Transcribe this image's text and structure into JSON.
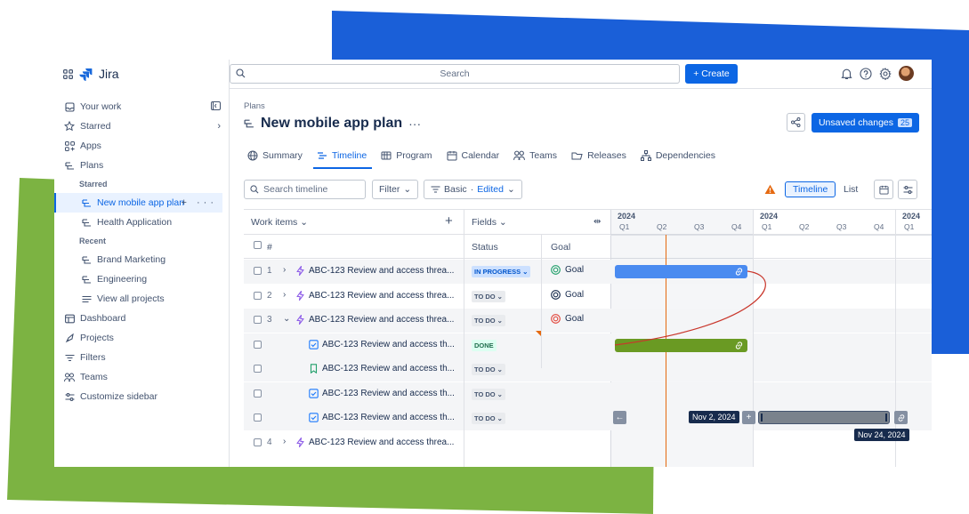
{
  "colors": {
    "accent": "#0c66e4",
    "deco_blue": "#1a5fd8",
    "deco_green": "#7cb342",
    "today_line": "#e56910"
  },
  "app": {
    "name": "Jira"
  },
  "sidebar": {
    "items": [
      {
        "label": "Your work",
        "icon": "your-work-icon"
      },
      {
        "label": "Starred",
        "icon": "star-icon"
      },
      {
        "label": "Apps",
        "icon": "apps-icon"
      },
      {
        "label": "Plans",
        "icon": "plans-icon"
      }
    ],
    "starred_heading": "Starred",
    "starred": [
      {
        "label": "New mobile app plan",
        "active": true
      },
      {
        "label": "Health Application"
      }
    ],
    "recent_heading": "Recent",
    "recent": [
      {
        "label": "Brand Marketing"
      },
      {
        "label": "Engineering"
      },
      {
        "label": "View all projects"
      }
    ],
    "bottom": [
      {
        "label": "Dashboard",
        "icon": "dashboard-icon"
      },
      {
        "label": "Projects",
        "icon": "projects-icon"
      },
      {
        "label": "Filters",
        "icon": "filter-icon"
      },
      {
        "label": "Teams",
        "icon": "teams-icon"
      },
      {
        "label": "Customize sidebar",
        "icon": "customize-icon"
      }
    ]
  },
  "topbar": {
    "search_placeholder": "Search",
    "create_label": "+ Create"
  },
  "header": {
    "breadcrumb": "Plans",
    "title": "New mobile app plan",
    "more": "···",
    "unsaved_label": "Unsaved changes",
    "unsaved_count": "25"
  },
  "tabs": [
    {
      "label": "Summary",
      "icon": "globe-icon"
    },
    {
      "label": "Timeline",
      "icon": "timeline-icon",
      "active": true
    },
    {
      "label": "Program",
      "icon": "program-icon"
    },
    {
      "label": "Calendar",
      "icon": "calendar-icon"
    },
    {
      "label": "Teams",
      "icon": "teams-icon"
    },
    {
      "label": "Releases",
      "icon": "releases-icon"
    },
    {
      "label": "Dependencies",
      "icon": "dependencies-icon"
    }
  ],
  "toolbar": {
    "search_placeholder": "Search timeline",
    "filter_label": "Filter",
    "basic_label": "Basic",
    "edited_label": "Edited",
    "view_timeline": "Timeline",
    "view_list": "List"
  },
  "grid": {
    "work_items_label": "Work items",
    "fields_label": "Fields",
    "hash": "#",
    "status_col": "Status",
    "goal_col": "Goal",
    "rows": [
      {
        "num": "1",
        "chev": "›",
        "title": "ABC-123 Review and access threa...",
        "status": "IN PROGRESS",
        "status_kind": "inprog",
        "goal": "Goal",
        "goal_color": "#22a06b",
        "type": "epic",
        "shade": true
      },
      {
        "num": "2",
        "chev": "›",
        "title": "ABC-123 Review and access threa...",
        "status": "TO DO",
        "status_kind": "todo",
        "goal": "Goal",
        "goal_color": "#172b4d",
        "type": "epic",
        "shade": false
      },
      {
        "num": "3",
        "chev": "⌄",
        "title": "ABC-123 Review and access threa...",
        "status": "TO DO",
        "status_kind": "todo",
        "goal": "Goal",
        "goal_color": "#e2483d",
        "type": "epic",
        "shade": true
      },
      {
        "num": "",
        "chev": "",
        "title": "ABC-123 Review and access th...",
        "status": "DONE",
        "status_kind": "done",
        "goal": "",
        "type": "task",
        "shade": true
      },
      {
        "num": "",
        "chev": "",
        "title": "ABC-123 Review and access th...",
        "status": "TO DO",
        "status_kind": "todo",
        "goal": "",
        "type": "story",
        "shade": true
      },
      {
        "num": "",
        "chev": "",
        "title": "ABC-123 Review and access th...",
        "status": "TO DO",
        "status_kind": "todo",
        "goal": "",
        "type": "task",
        "shade": true
      },
      {
        "num": "",
        "chev": "",
        "title": "ABC-123 Review and access th...",
        "status": "TO DO",
        "status_kind": "todo",
        "goal": "",
        "type": "task",
        "shade": true
      },
      {
        "num": "4",
        "chev": "›",
        "title": "ABC-123 Review and access threa...",
        "status": "",
        "status_kind": "",
        "goal": "",
        "type": "epic",
        "shade": false
      }
    ]
  },
  "timeline": {
    "years": [
      "2024",
      "2024",
      "2024"
    ],
    "quarters": [
      "Q1",
      "Q2",
      "Q3",
      "Q4",
      "Q1",
      "Q2",
      "Q3",
      "Q4",
      "Q1"
    ],
    "tooltip_start": "Nov 2, 2024",
    "tooltip_end": "Nov 24, 2024"
  }
}
